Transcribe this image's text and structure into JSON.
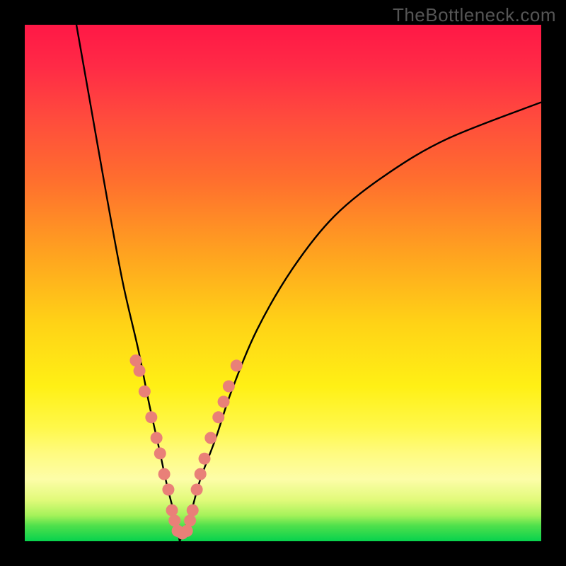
{
  "watermark": "TheBottleneck.com",
  "chart_data": {
    "type": "line",
    "title": "",
    "xlabel": "",
    "ylabel": "",
    "xlim": [
      0,
      100
    ],
    "ylim": [
      0,
      100
    ],
    "description": "Bottleneck chart with rainbow gradient background (red at top through yellow to green at bottom). Two black curves descend from upper edges into a narrow V near x≈30 at the bottom. Salmon-colored dot markers cluster along both branches near the lower portion of the V.",
    "series": [
      {
        "name": "left-branch",
        "x": [
          10,
          13,
          16,
          19,
          22,
          24,
          26,
          27.5,
          29,
          30
        ],
        "y": [
          100,
          83,
          66,
          50,
          37,
          27,
          18,
          11,
          5,
          0
        ]
      },
      {
        "name": "right-branch",
        "x": [
          30,
          32,
          34,
          37,
          40,
          45,
          52,
          60,
          70,
          82,
          100
        ],
        "y": [
          0,
          5,
          12,
          20,
          29,
          41,
          53,
          63,
          71,
          78,
          85
        ]
      }
    ],
    "markers": {
      "name": "overlay-dots",
      "color": "#e98078",
      "points": [
        {
          "x": 21.5,
          "y": 35
        },
        {
          "x": 22.2,
          "y": 33
        },
        {
          "x": 23.2,
          "y": 29
        },
        {
          "x": 24.5,
          "y": 24
        },
        {
          "x": 25.5,
          "y": 20
        },
        {
          "x": 26.2,
          "y": 17
        },
        {
          "x": 27.0,
          "y": 13
        },
        {
          "x": 27.8,
          "y": 10
        },
        {
          "x": 28.5,
          "y": 6
        },
        {
          "x": 29.0,
          "y": 4
        },
        {
          "x": 29.6,
          "y": 2
        },
        {
          "x": 30.5,
          "y": 1.5
        },
        {
          "x": 31.4,
          "y": 2
        },
        {
          "x": 32.0,
          "y": 4
        },
        {
          "x": 32.5,
          "y": 6
        },
        {
          "x": 33.3,
          "y": 10
        },
        {
          "x": 34.0,
          "y": 13
        },
        {
          "x": 34.8,
          "y": 16
        },
        {
          "x": 36.0,
          "y": 20
        },
        {
          "x": 37.5,
          "y": 24
        },
        {
          "x": 38.5,
          "y": 27
        },
        {
          "x": 39.5,
          "y": 30
        },
        {
          "x": 41.0,
          "y": 34
        }
      ]
    }
  }
}
